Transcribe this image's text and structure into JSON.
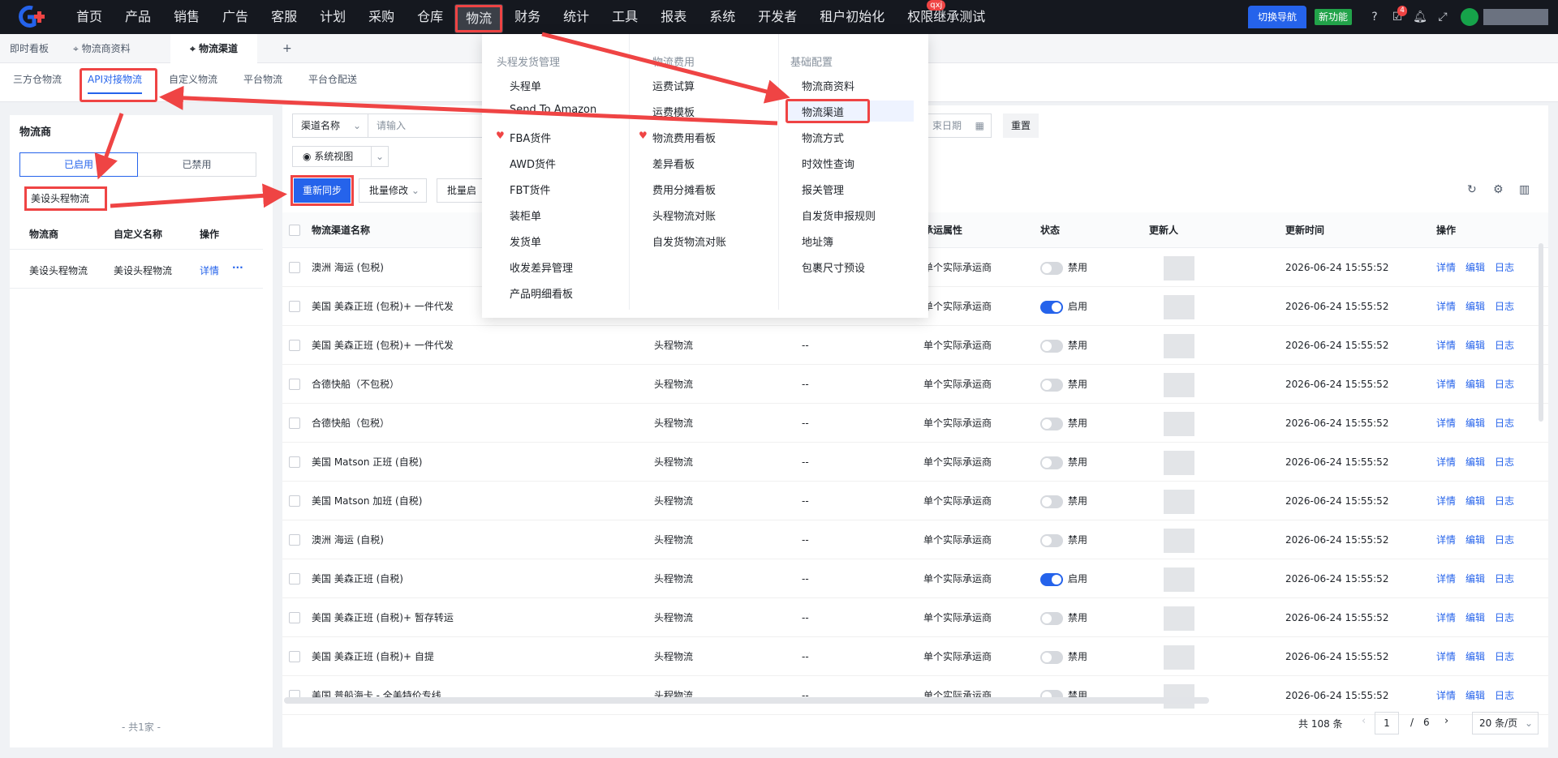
{
  "topbar": {
    "nav": [
      {
        "label": "首页"
      },
      {
        "label": "产品"
      },
      {
        "label": "销售"
      },
      {
        "label": "广告"
      },
      {
        "label": "客服"
      },
      {
        "label": "计划"
      },
      {
        "label": "采购"
      },
      {
        "label": "仓库"
      },
      {
        "label": "物流"
      },
      {
        "label": "财务"
      },
      {
        "label": "统计"
      },
      {
        "label": "工具"
      },
      {
        "label": "报表"
      },
      {
        "label": "系统"
      },
      {
        "label": "开发者"
      },
      {
        "label": "租户初始化"
      },
      {
        "label": "权限继承测试"
      }
    ],
    "nav_badge": "qxj",
    "switch_nav": "切换导航",
    "new_feature": "新功能",
    "task_badge": "4"
  },
  "page_tabs": [
    {
      "label": "即时看板"
    },
    {
      "label": "物流商资料"
    },
    {
      "label": "物流渠道"
    },
    {
      "label": "+"
    }
  ],
  "sub_tabs": [
    {
      "label": "三方仓物流"
    },
    {
      "label": "API对接物流"
    },
    {
      "label": "自定义物流"
    },
    {
      "label": "平台物流"
    },
    {
      "label": "平台仓配送"
    }
  ],
  "left_panel": {
    "title": "物流商",
    "seg_enabled": "已启用",
    "seg_disabled": "已禁用",
    "selected_provider": "美设头程物流",
    "columns": [
      "物流商",
      "自定义名称",
      "操作"
    ],
    "rows": [
      {
        "provider": "美设头程物流",
        "custom": "美设头程物流",
        "action": "详情",
        "more": "···"
      }
    ],
    "footer": "- 共1家 -"
  },
  "filters": {
    "field": "渠道名称",
    "placeholder": "请输入",
    "date_placeholder": "束日期",
    "reset": "重置",
    "view": "系统视图"
  },
  "toolbar": {
    "resync": "重新同步",
    "batch_edit": "批量修改",
    "batch_enable": "批量启用"
  },
  "table": {
    "headers": {
      "name": "物流渠道名称",
      "attr": "承运属性",
      "status": "状态",
      "updater": "更新人",
      "updated": "更新时间",
      "ops": "操作"
    },
    "ops": {
      "detail": "详情",
      "edit": "编辑",
      "log": "日志"
    },
    "rows": [
      {
        "name": "澳洲 海运 (包税)",
        "type": "",
        "dash": "",
        "attr": "单个实际承运商",
        "on": false,
        "status": "禁用",
        "time": "2026-06-24 15:55:52"
      },
      {
        "name": "美国 美森正班 (包税)+ 一件代发",
        "type": "",
        "dash": "",
        "attr": "单个实际承运商",
        "on": true,
        "status": "启用",
        "time": "2026-06-24 15:55:52"
      },
      {
        "name": "美国 美森正班 (包税)+ 一件代发",
        "type": "头程物流",
        "dash": "--",
        "attr": "单个实际承运商",
        "on": false,
        "status": "禁用",
        "time": "2026-06-24 15:55:52"
      },
      {
        "name": "合德快船（不包税）",
        "type": "头程物流",
        "dash": "--",
        "attr": "单个实际承运商",
        "on": false,
        "status": "禁用",
        "time": "2026-06-24 15:55:52"
      },
      {
        "name": "合德快船（包税）",
        "type": "头程物流",
        "dash": "--",
        "attr": "单个实际承运商",
        "on": false,
        "status": "禁用",
        "time": "2026-06-24 15:55:52"
      },
      {
        "name": "美国 Matson 正班 (自税)",
        "type": "头程物流",
        "dash": "--",
        "attr": "单个实际承运商",
        "on": false,
        "status": "禁用",
        "time": "2026-06-24 15:55:52"
      },
      {
        "name": "美国 Matson 加班 (自税)",
        "type": "头程物流",
        "dash": "--",
        "attr": "单个实际承运商",
        "on": false,
        "status": "禁用",
        "time": "2026-06-24 15:55:52"
      },
      {
        "name": "澳洲 海运 (自税)",
        "type": "头程物流",
        "dash": "--",
        "attr": "单个实际承运商",
        "on": false,
        "status": "禁用",
        "time": "2026-06-24 15:55:52"
      },
      {
        "name": "美国 美森正班 (自税)",
        "type": "头程物流",
        "dash": "--",
        "attr": "单个实际承运商",
        "on": true,
        "status": "启用",
        "time": "2026-06-24 15:55:52"
      },
      {
        "name": "美国 美森正班 (自税)+ 暂存转运",
        "type": "头程物流",
        "dash": "--",
        "attr": "单个实际承运商",
        "on": false,
        "status": "禁用",
        "time": "2026-06-24 15:55:52"
      },
      {
        "name": "美国 美森正班 (自税)+ 自提",
        "type": "头程物流",
        "dash": "--",
        "attr": "单个实际承运商",
        "on": false,
        "status": "禁用",
        "time": "2026-06-24 15:55:52"
      },
      {
        "name": "美国 普船海卡 - 全美特价专线",
        "type": "头程物流",
        "dash": "--",
        "attr": "单个实际承运商",
        "on": false,
        "status": "禁用",
        "time": "2026-06-24 15:55:52"
      }
    ]
  },
  "pagination": {
    "total": "共 108 条",
    "page": "1",
    "sep": "/",
    "pages": "6",
    "page_size": "20 条/页"
  },
  "dropdown": {
    "col1": {
      "head": "头程发货管理",
      "items": [
        "头程单",
        "Send To Amazon",
        "FBA货件",
        "AWD货件",
        "FBT货件",
        "装柜单",
        "发货单",
        "收发差异管理",
        "产品明细看板"
      ]
    },
    "col2": {
      "head": "物流费用",
      "items": [
        "运费试算",
        "运费模板",
        "物流费用看板",
        "差异看板",
        "费用分摊看板",
        "头程物流对账",
        "自发货物流对账"
      ]
    },
    "col3": {
      "head": "基础配置",
      "items": [
        "物流商资料",
        "物流渠道",
        "物流方式",
        "时效性查询",
        "报关管理",
        "自发货申报规则",
        "地址簿",
        "包裹尺寸预设"
      ]
    }
  },
  "colors": {
    "accent": "#2563eb",
    "highlight": "#ef4444",
    "topbar": "#15181f"
  }
}
